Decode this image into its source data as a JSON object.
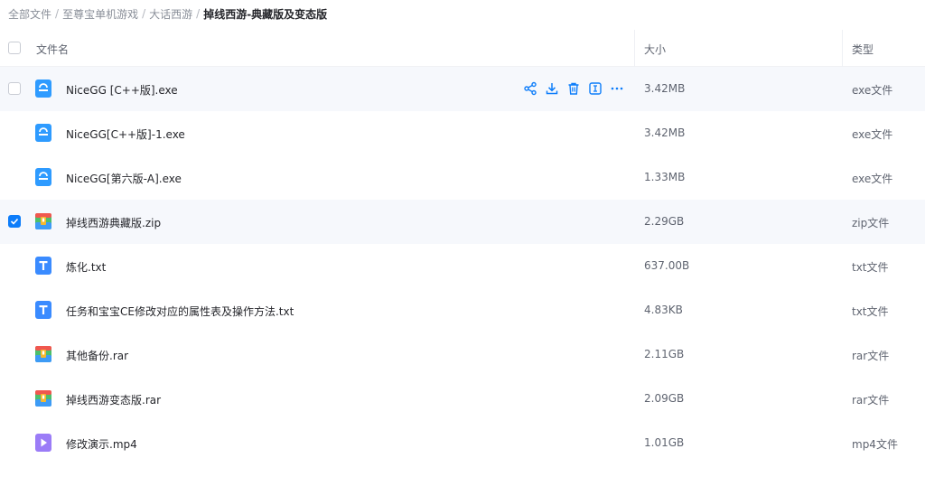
{
  "breadcrumb": {
    "items": [
      "全部文件",
      "至尊宝单机游戏",
      "大话西游"
    ],
    "current": "掉线西游-典藏版及变态版",
    "separator": "/"
  },
  "table": {
    "columns": {
      "name": "文件名",
      "size": "大小",
      "type": "类型"
    },
    "rows": [
      {
        "name": "NiceGG [C++版].exe",
        "size": "3.42MB",
        "type": "exe文件",
        "icon": "exe-file-icon",
        "checked": false,
        "state": "hover"
      },
      {
        "name": "NiceGG[C++版]-1.exe",
        "size": "3.42MB",
        "type": "exe文件",
        "icon": "exe-file-icon",
        "checked": false,
        "state": "normal"
      },
      {
        "name": "NiceGG[第六版-A].exe",
        "size": "1.33MB",
        "type": "exe文件",
        "icon": "exe-file-icon",
        "checked": false,
        "state": "normal"
      },
      {
        "name": "掉线西游典藏版.zip",
        "size": "2.29GB",
        "type": "zip文件",
        "icon": "archive-file-icon",
        "checked": true,
        "state": "selected"
      },
      {
        "name": "炼化.txt",
        "size": "637.00B",
        "type": "txt文件",
        "icon": "text-file-icon",
        "checked": false,
        "state": "normal"
      },
      {
        "name": "任务和宝宝CE修改对应的属性表及操作方法.txt",
        "size": "4.83KB",
        "type": "txt文件",
        "icon": "text-file-icon",
        "checked": false,
        "state": "normal"
      },
      {
        "name": "其他备份.rar",
        "size": "2.11GB",
        "type": "rar文件",
        "icon": "archive-file-icon",
        "checked": false,
        "state": "normal"
      },
      {
        "name": "掉线西游变态版.rar",
        "size": "2.09GB",
        "type": "rar文件",
        "icon": "archive-file-icon",
        "checked": false,
        "state": "normal"
      },
      {
        "name": "修改演示.mp4",
        "size": "1.01GB",
        "type": "mp4文件",
        "icon": "video-file-icon",
        "checked": false,
        "state": "normal"
      }
    ],
    "row_actions": [
      "share-icon",
      "download-icon",
      "delete-icon",
      "rename-icon",
      "more-icon"
    ]
  },
  "colors": {
    "accent": "#0d7dfa",
    "exe_icon": "#2e9bff",
    "txt_icon": "#3a8bff",
    "video_icon": "#9b7cf7",
    "archive_red": "#f0574f",
    "archive_green": "#4cbf6b",
    "archive_yellow": "#f5b82e",
    "archive_blue": "#3d9bf5"
  }
}
